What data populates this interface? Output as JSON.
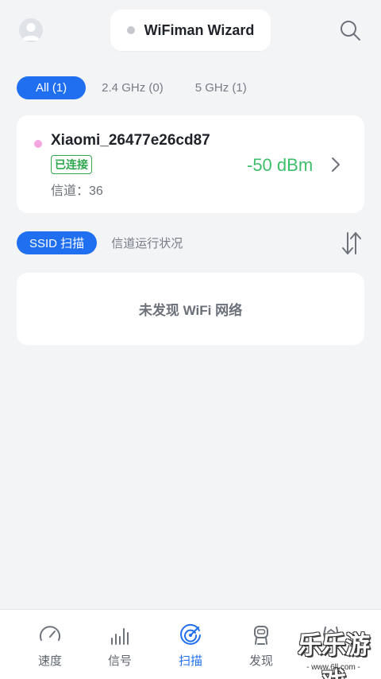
{
  "header": {
    "title": "WiFiman Wizard",
    "icons": {
      "avatar": "user-avatar-icon",
      "search": "search-icon"
    }
  },
  "filters": [
    {
      "label": "All (1)",
      "active": true
    },
    {
      "label": "2.4 GHz (0)",
      "active": false
    },
    {
      "label": "5 GHz (1)",
      "active": false
    }
  ],
  "network": {
    "ssid": "Xiaomi_26477e26cd87",
    "status_badge": "已连接",
    "channel_label": "信道：36",
    "signal": "-50 dBm",
    "dot_color": "#f3a6df",
    "signal_color": "#3dbf6a"
  },
  "scan_tabs": [
    {
      "label": "SSID 扫描",
      "active": true
    },
    {
      "label": "信道运行状况",
      "active": false
    }
  ],
  "empty_state": {
    "message": "未发现 WiFi 网络"
  },
  "tabbar": [
    {
      "label": "速度",
      "icon": "speedometer-icon",
      "active": false
    },
    {
      "label": "信号",
      "icon": "signal-bars-icon",
      "active": false
    },
    {
      "label": "扫描",
      "icon": "radar-scan-icon",
      "active": true
    },
    {
      "label": "发现",
      "icon": "discovery-robot-icon",
      "active": false
    },
    {
      "label": "",
      "icon": "more-icon",
      "active": false
    }
  ],
  "watermark": {
    "text": "乐乐游戏",
    "url": "- www.6ll.com -"
  },
  "colors": {
    "accent": "#1f6ff0",
    "background": "#f3f4f6",
    "success": "#2fa84f"
  }
}
